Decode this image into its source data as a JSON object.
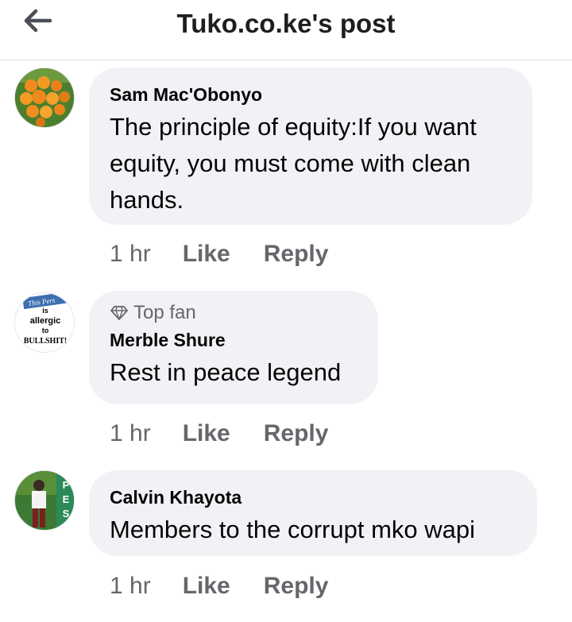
{
  "header": {
    "title": "Tuko.co.ke's post"
  },
  "comments": [
    {
      "author": "Sam Mac'Obonyo",
      "text_lines": [
        "The principle of equity:If you want",
        "equity, you must come with clean",
        "hands."
      ],
      "time": "1 hr",
      "like_label": "Like",
      "reply_label": "Reply"
    },
    {
      "badge": "Top fan",
      "author": "Merble Shure",
      "text_lines": [
        "Rest in peace legend"
      ],
      "time": "1 hr",
      "like_label": "Like",
      "reply_label": "Reply",
      "avatar_text": [
        "This Pers",
        "is",
        "allergic",
        "to",
        "BULLSHIT!"
      ]
    },
    {
      "author": "Calvin Khayota",
      "text_lines": [
        "Members to the corrupt mko wapi"
      ],
      "time": "1 hr",
      "like_label": "Like",
      "reply_label": "Reply",
      "avatar_text": [
        "P",
        "E",
        "S"
      ]
    }
  ],
  "icons": {
    "back": "arrow-left-icon",
    "badge": "diamond-icon"
  },
  "colors": {
    "bubble": "#f0f2f5",
    "secondary_text": "#65676b",
    "primary_text": "#050505"
  }
}
